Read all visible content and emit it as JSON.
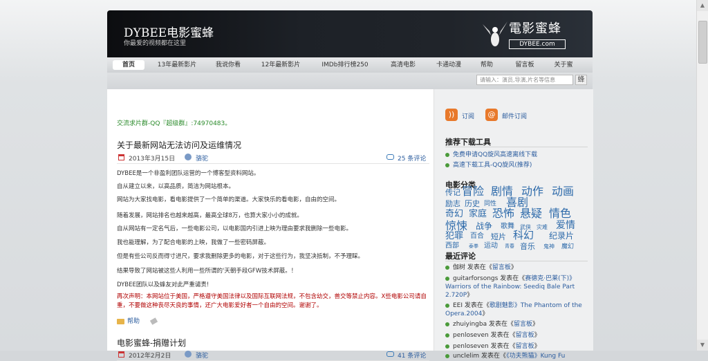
{
  "header": {
    "title": "DYBEE电影蜜蜂",
    "subtitle": "你最爱的视频都在这里",
    "logo_text": "電影蜜蜂",
    "logo_badge": "DYBEE.com"
  },
  "nav": {
    "items": [
      "首页",
      "13年最新影片",
      "我说你看",
      "12年最新影片",
      "IMDb排行榜250",
      "高清电影",
      "卡通动漫",
      "帮助",
      "留言板",
      "关于蜜"
    ]
  },
  "search": {
    "placeholder": "请输入：演员,导演,片名等信息",
    "button": "蜂"
  },
  "main": {
    "qq_group": "交流求片群-QQ『超级群』:74970483。",
    "posts": [
      {
        "title": "关于最新网站无法访问及运维情况",
        "date": "2013年3月15日",
        "author": "骆驼",
        "comments": "25 条评论",
        "paragraphs": [
          "DYBEE是一个非盈利团队运营的一个博客型资料网站。",
          "自从建立以来，以高品质，简洁为网站根本。",
          "网站为大家找电影，看电影提供了一个简单的渠道。大家快乐的看电影，自由的空间。",
          "随着发展，网站排名也越来越高，最高全球8万，也算大家小小的成就。",
          "自从网站有一定名气后，一些电影公司，以电影国内引进上映为理由要求我删除一些电影。",
          "我也能理解，为了配合电影的上映，我做了一些密码屏蔽。",
          "但是有些公司反而得寸进尺，要求我删除更多的电影，对于这些行为，我坚决抵制，不予理睬。",
          "结果导致了网站被这些人利用一些所谓的'天朝手段GFW技术屏蔽。！",
          "DYBEE团队以及蜂友对此严重谴责!"
        ],
        "warning": "再次声明：本网站位于美国，严格遵守美国法律以及国际互联网法规，不包含幼交，兽交等禁止内容。X些电影公司请自重，不要做这种丧尽天良的事情，还广大电影爱好者一个自由的空间。谢谢了。",
        "tag": "帮助"
      },
      {
        "title": "电影蜜蜂-捐赠计划",
        "date": "2012年2月2日",
        "author": "骆驼",
        "comments": "41 条评论"
      }
    ]
  },
  "sidebar": {
    "subscribe": {
      "rss": "订阅",
      "mail": "邮件订阅"
    },
    "tools": {
      "title": "推荐下载工具",
      "items": [
        "免费申请QQ旋风高速离线下载",
        "高速下载工具-QQ旋风(推荐)"
      ]
    },
    "categories": {
      "title": "电影分类",
      "tags": [
        "传记",
        "冒险",
        "剧情",
        "动作",
        "动画",
        "励志",
        "历史",
        "同性",
        "喜剧",
        "奇幻",
        "家庭",
        "恐怖",
        "悬疑",
        "情色",
        "惊悚",
        "战争",
        "歌舞",
        "武侠",
        "灾难",
        "爱情",
        "犯罪",
        "百合",
        "短片",
        "科幻",
        "纪录片",
        "西部",
        "泰拳",
        "运动",
        "青春",
        "音乐",
        "鬼神",
        "魔幻"
      ]
    },
    "recent": {
      "title": "最近评论",
      "items": [
        {
          "user": "伽树",
          "verb": "发表在《",
          "target": "留言板",
          "end": "》"
        },
        {
          "user": "guitarforsongs",
          "verb": "发表在《",
          "target": "赛德克·巴莱(下)》Warriors of the Rainbow: Seediq Bale Part 2.720P",
          "end": "》"
        },
        {
          "user": "EEI",
          "verb": "发表在《",
          "target": "歌剧魅影》The Phantom of the Opera.2004",
          "end": "》"
        },
        {
          "user": "zhuiyingba",
          "verb": "发表在《",
          "target": "留言板",
          "end": "》"
        },
        {
          "user": "penloseven",
          "verb": "发表在《",
          "target": "留言板",
          "end": "》"
        },
        {
          "user": "penloseven",
          "verb": "发表在《",
          "target": "留言板",
          "end": "》"
        },
        {
          "user": "unclelim",
          "verb": "发表在《",
          "target": "《功夫熊猫》Kung Fu",
          "end": ""
        }
      ]
    }
  }
}
